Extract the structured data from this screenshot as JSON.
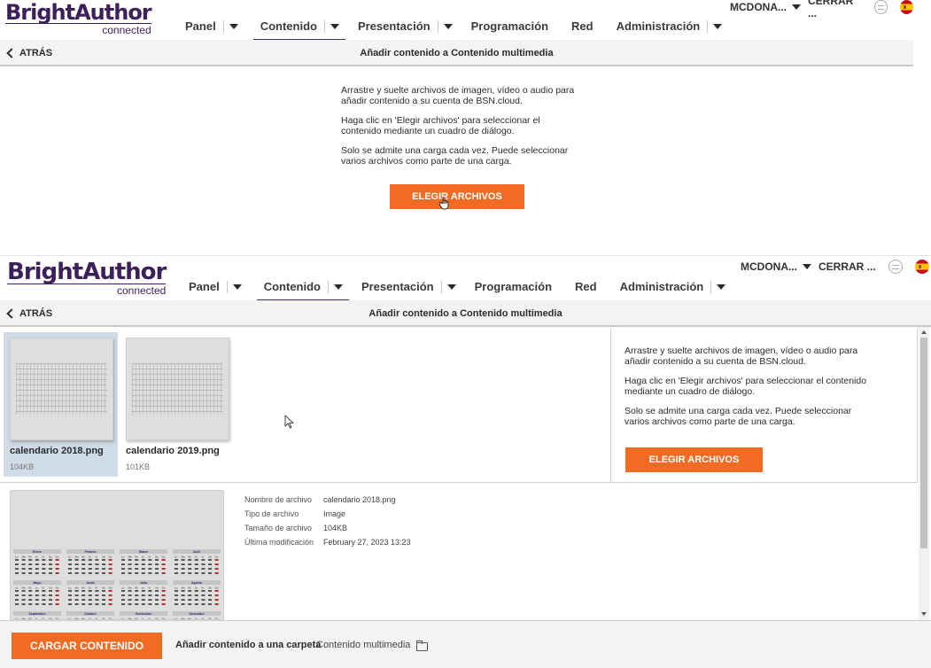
{
  "header": {
    "logo_main": "BrightAuthor",
    "logo_sub": "connected",
    "nav": [
      {
        "label": "Panel"
      },
      {
        "label": "Contenido"
      },
      {
        "label": "Presentación"
      },
      {
        "label": "Programación"
      },
      {
        "label": "Red"
      },
      {
        "label": "Administración"
      }
    ],
    "user": "MCDONA...",
    "logout": "CERRAR ..."
  },
  "subbar": {
    "back_label": "ATRÁS",
    "title": "Añadir contenido a Contenido multimedia"
  },
  "upload_info": {
    "p1": "Arrastre y suelte archivos de imagen, vídeo o audio para añadir contenido a su cuenta de BSN.cloud.",
    "p2": "Haga clic en 'Elegir archivos' para seleccionar el contenido mediante un cuadro de diálogo.",
    "p3": "Solo se admite una carga cada vez. Puede seleccionar varios archivos como parte de una carga.",
    "button": "ELEGIR ARCHIVOS"
  },
  "files": [
    {
      "name": "calendario 2018.png",
      "size": "104KB",
      "selected": true
    },
    {
      "name": "calendario 2019.png",
      "size": "101KB",
      "selected": false
    }
  ],
  "details": {
    "rows": [
      {
        "label": "Nombre de archivo",
        "value": "calendario 2018.png"
      },
      {
        "label": "Tipo de archivo",
        "value": "Image"
      },
      {
        "label": "Tamaño de archivo",
        "value": "104KB"
      },
      {
        "label": "Última modificación",
        "value": "February 27, 2023 13:23"
      }
    ]
  },
  "calendar_preview": {
    "months": [
      "Enero",
      "Febrero",
      "Marzo",
      "Abril",
      "Mayo",
      "Junio",
      "Julio",
      "Agosto",
      "Septiembre",
      "Octubre",
      "Noviembre",
      "Diciembre"
    ],
    "weekdays": [
      "Lu",
      "Ma",
      "Mi",
      "Ju",
      "Vi",
      "Sá",
      "Do"
    ]
  },
  "bottom_bar": {
    "upload_button": "CARGAR CONTENIDO",
    "folder_label": "Añadir contenido a una carpeta",
    "folder_value": "Contenido multimedia"
  },
  "colors": {
    "accent": "#f26b22",
    "brand": "#3d1f5c",
    "selected_tile": "#cfdbe6"
  }
}
